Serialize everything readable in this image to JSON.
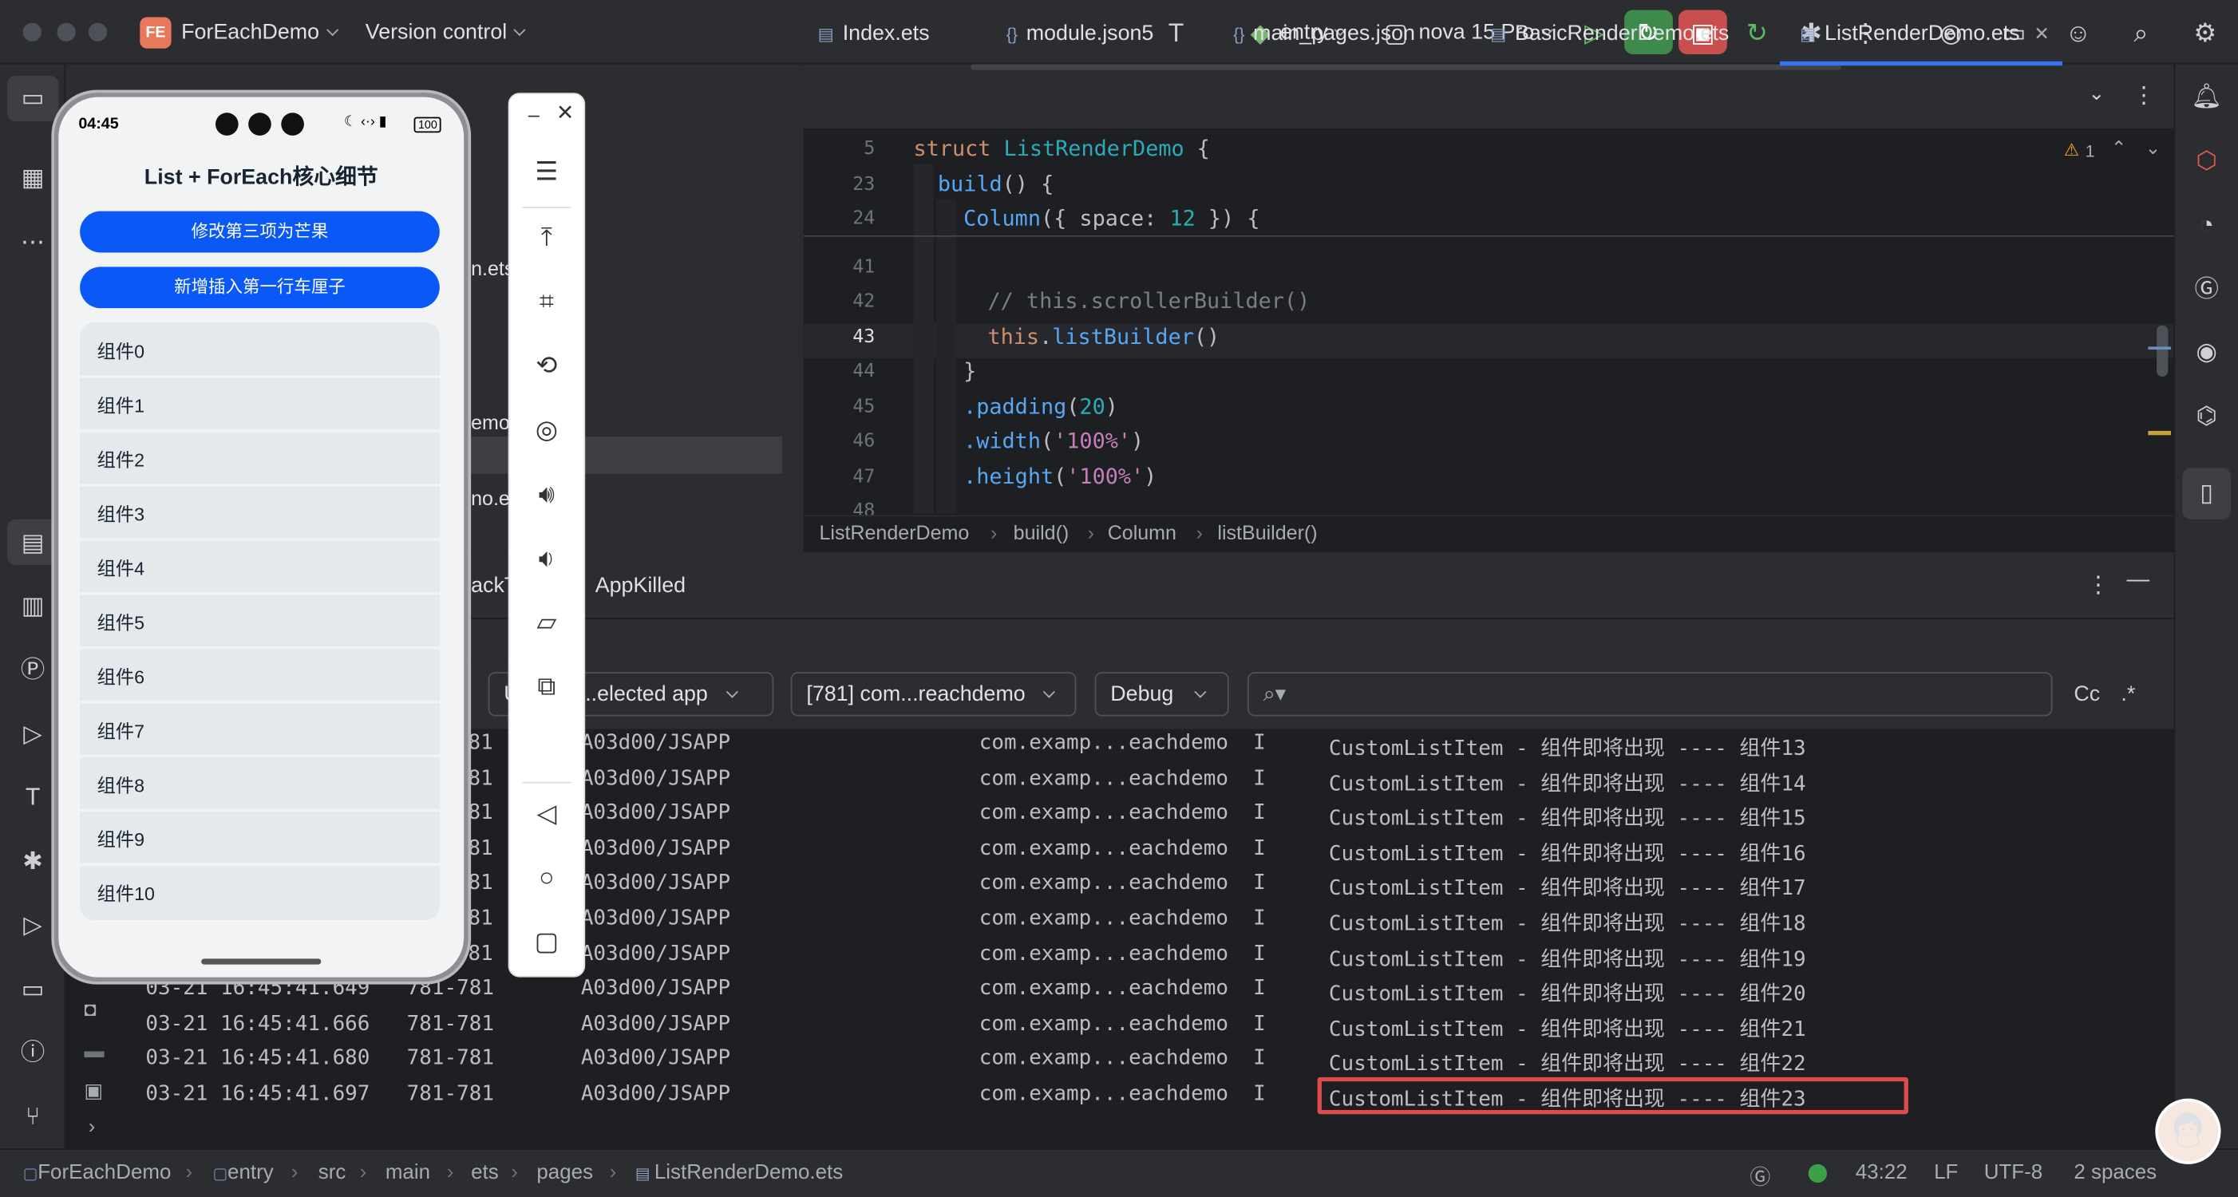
{
  "title_bar": {
    "project_badge": "FE",
    "project_name": "ForEachDemo",
    "vcs": "Version control",
    "module": "entry",
    "device": "nova 15 Pro"
  },
  "phone": {
    "time": "04:45",
    "status_right": "100",
    "title": "List + ForEach核心细节",
    "button1": "修改第三项为芒果",
    "button2": "新增插入第一行车厘子",
    "items": [
      "组件0",
      "组件1",
      "组件2",
      "组件3",
      "组件4",
      "组件5",
      "组件6",
      "组件7",
      "组件8",
      "组件9",
      "组件10"
    ]
  },
  "left_panel_fragments": {
    "f1": "n.ets",
    "f2": "emo.",
    "f3": "no.et",
    "f4": "ackT",
    "f5": "AppKilled",
    "f6": "U"
  },
  "editor": {
    "tabs": [
      {
        "label": "Index.ets",
        "icon": "ets-file-icon"
      },
      {
        "label": "module.json5",
        "icon": "json-file-icon"
      },
      {
        "label": "main_pages.json",
        "icon": "json-file-icon"
      },
      {
        "label": "BasicRenderDemo.ets",
        "icon": "ets-file-icon"
      },
      {
        "label": "ListRenderDemo.ets",
        "icon": "ets-file-icon"
      }
    ],
    "warning_count": "1",
    "sticky": [
      {
        "n": "5",
        "kw": "struct",
        "name": "ListRenderDemo",
        "rest": " {"
      },
      {
        "n": "23",
        "fn": "build",
        "rest": "() {"
      },
      {
        "n": "24",
        "fn": "Column",
        "pre": "({ ",
        "key": "space",
        "mid": ": ",
        "num": "12",
        "rest": " }) {"
      }
    ],
    "lines": [
      {
        "n": "41"
      },
      {
        "n": "42",
        "text": "// this.scrollerBuilder()"
      },
      {
        "n": "43",
        "kw": "this",
        "fn": "listBuilder",
        "rest": "()"
      },
      {
        "n": "44",
        "text": "}"
      },
      {
        "n": "45",
        "fn": ".padding",
        "num": "20"
      },
      {
        "n": "46",
        "fn": ".width",
        "str": "'100%'"
      },
      {
        "n": "47",
        "fn": ".height",
        "str": "'100%'"
      },
      {
        "n": "48"
      }
    ],
    "breadcrumb": [
      "ListRenderDemo",
      "build()",
      "Column",
      "listBuilder()"
    ]
  },
  "log": {
    "filter_app": "...elected app",
    "filter_process": "[781] com...reachdemo",
    "filter_level": "Debug",
    "search_placeholder": "",
    "cc": "Cc",
    "regex": ".*",
    "rows": [
      {
        "time": "",
        "pid": "81",
        "tag": "A03d00/JSAPP",
        "pkg": "com.examp...eachdemo",
        "lvl": "I",
        "msg": "CustomListItem - 组件即将出现 ---- 组件13"
      },
      {
        "time": "",
        "pid": "81",
        "tag": "A03d00/JSAPP",
        "pkg": "com.examp...eachdemo",
        "lvl": "I",
        "msg": "CustomListItem - 组件即将出现 ---- 组件14"
      },
      {
        "time": "",
        "pid": "81",
        "tag": "A03d00/JSAPP",
        "pkg": "com.examp...eachdemo",
        "lvl": "I",
        "msg": "CustomListItem - 组件即将出现 ---- 组件15"
      },
      {
        "time": "",
        "pid": "81",
        "tag": "A03d00/JSAPP",
        "pkg": "com.examp...eachdemo",
        "lvl": "I",
        "msg": "CustomListItem - 组件即将出现 ---- 组件16"
      },
      {
        "time": "",
        "pid": "81",
        "tag": "A03d00/JSAPP",
        "pkg": "com.examp...eachdemo",
        "lvl": "I",
        "msg": "CustomListItem - 组件即将出现 ---- 组件17"
      },
      {
        "time": "",
        "pid": "81",
        "tag": "A03d00/JSAPP",
        "pkg": "com.examp...eachdemo",
        "lvl": "I",
        "msg": "CustomListItem - 组件即将出现 ---- 组件18"
      },
      {
        "time": "",
        "pid": "81",
        "tag": "A03d00/JSAPP",
        "pkg": "com.examp...eachdemo",
        "lvl": "I",
        "msg": "CustomListItem - 组件即将出现 ---- 组件19"
      },
      {
        "time": "03-21 16:45:41.649",
        "pid": "781-781",
        "tag": "A03d00/JSAPP",
        "pkg": "com.examp...eachdemo",
        "lvl": "I",
        "msg": "CustomListItem - 组件即将出现 ---- 组件20"
      },
      {
        "time": "03-21 16:45:41.666",
        "pid": "781-781",
        "tag": "A03d00/JSAPP",
        "pkg": "com.examp...eachdemo",
        "lvl": "I",
        "msg": "CustomListItem - 组件即将出现 ---- 组件21"
      },
      {
        "time": "03-21 16:45:41.680",
        "pid": "781-781",
        "tag": "A03d00/JSAPP",
        "pkg": "com.examp...eachdemo",
        "lvl": "I",
        "msg": "CustomListItem - 组件即将出现 ---- 组件22"
      },
      {
        "time": "03-21 16:45:41.697",
        "pid": "781-781",
        "tag": "A03d00/JSAPP",
        "pkg": "com.examp...eachdemo",
        "lvl": "I",
        "msg": "CustomListItem - 组件即将出现 ---- 组件23"
      }
    ]
  },
  "status_bar": {
    "path": [
      "ForEachDemo",
      "entry",
      "src",
      "main",
      "ets",
      "pages",
      "ListRenderDemo.ets"
    ],
    "position": "43:22",
    "line_sep": "LF",
    "encoding": "UTF-8",
    "indent": "2 spaces"
  },
  "colors": {
    "accent": "#3574f0",
    "highlight_box": "#e04b4b",
    "phone_button": "#0a59f7"
  }
}
